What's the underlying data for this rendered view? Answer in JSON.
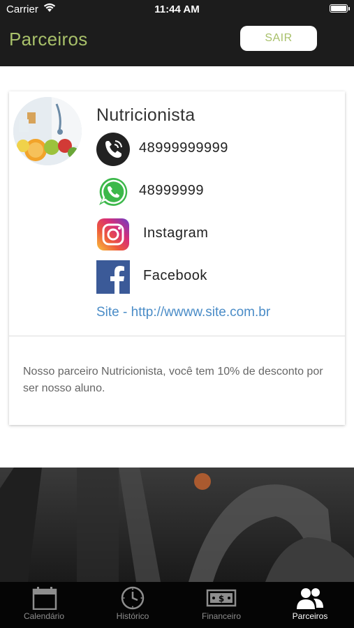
{
  "status_bar": {
    "carrier": "Carrier",
    "time": "11:44 AM"
  },
  "header": {
    "title": "Parceiros",
    "logout_label": "SAIR"
  },
  "partner": {
    "name": "Nutricionista",
    "phone": "48999999999",
    "whatsapp": "48999999",
    "instagram": "Instagram",
    "facebook": "Facebook",
    "site": "Site - http://wwww.site.com.br",
    "description": "Nosso parceiro Nutricionista, você tem 10% de desconto por ser nosso aluno."
  },
  "tabs": [
    {
      "label": "Calendário",
      "icon": "calendar-icon"
    },
    {
      "label": "Histórico",
      "icon": "clock-icon"
    },
    {
      "label": "Financeiro",
      "icon": "money-icon"
    },
    {
      "label": "Parceiros",
      "icon": "partners-icon",
      "active": true
    }
  ],
  "colors": {
    "accent": "#a8c06a",
    "link": "#4a8cc7",
    "header_bg": "#1c1c1c",
    "tabbar_bg": "#050505"
  }
}
